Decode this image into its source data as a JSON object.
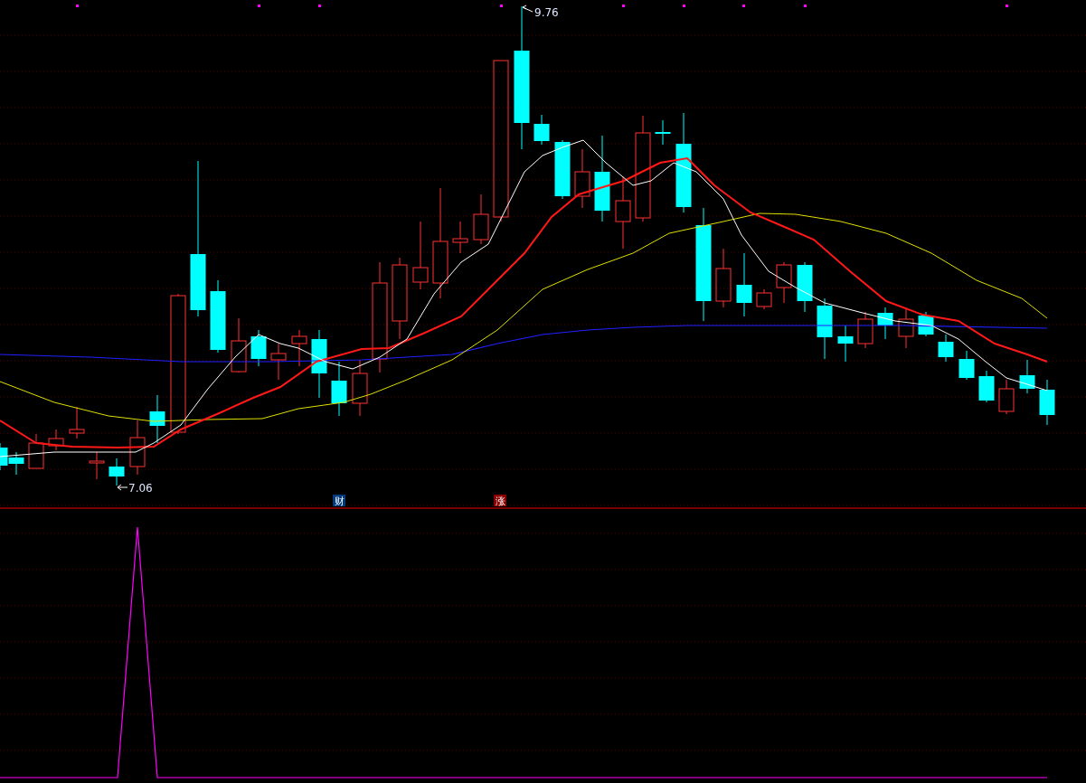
{
  "price_chart": {
    "high_label": "9.76",
    "low_label": "7.06"
  },
  "event_markers": [
    {
      "text": "财",
      "kind": "finance"
    },
    {
      "text": "涨",
      "kind": "rise"
    }
  ]
}
